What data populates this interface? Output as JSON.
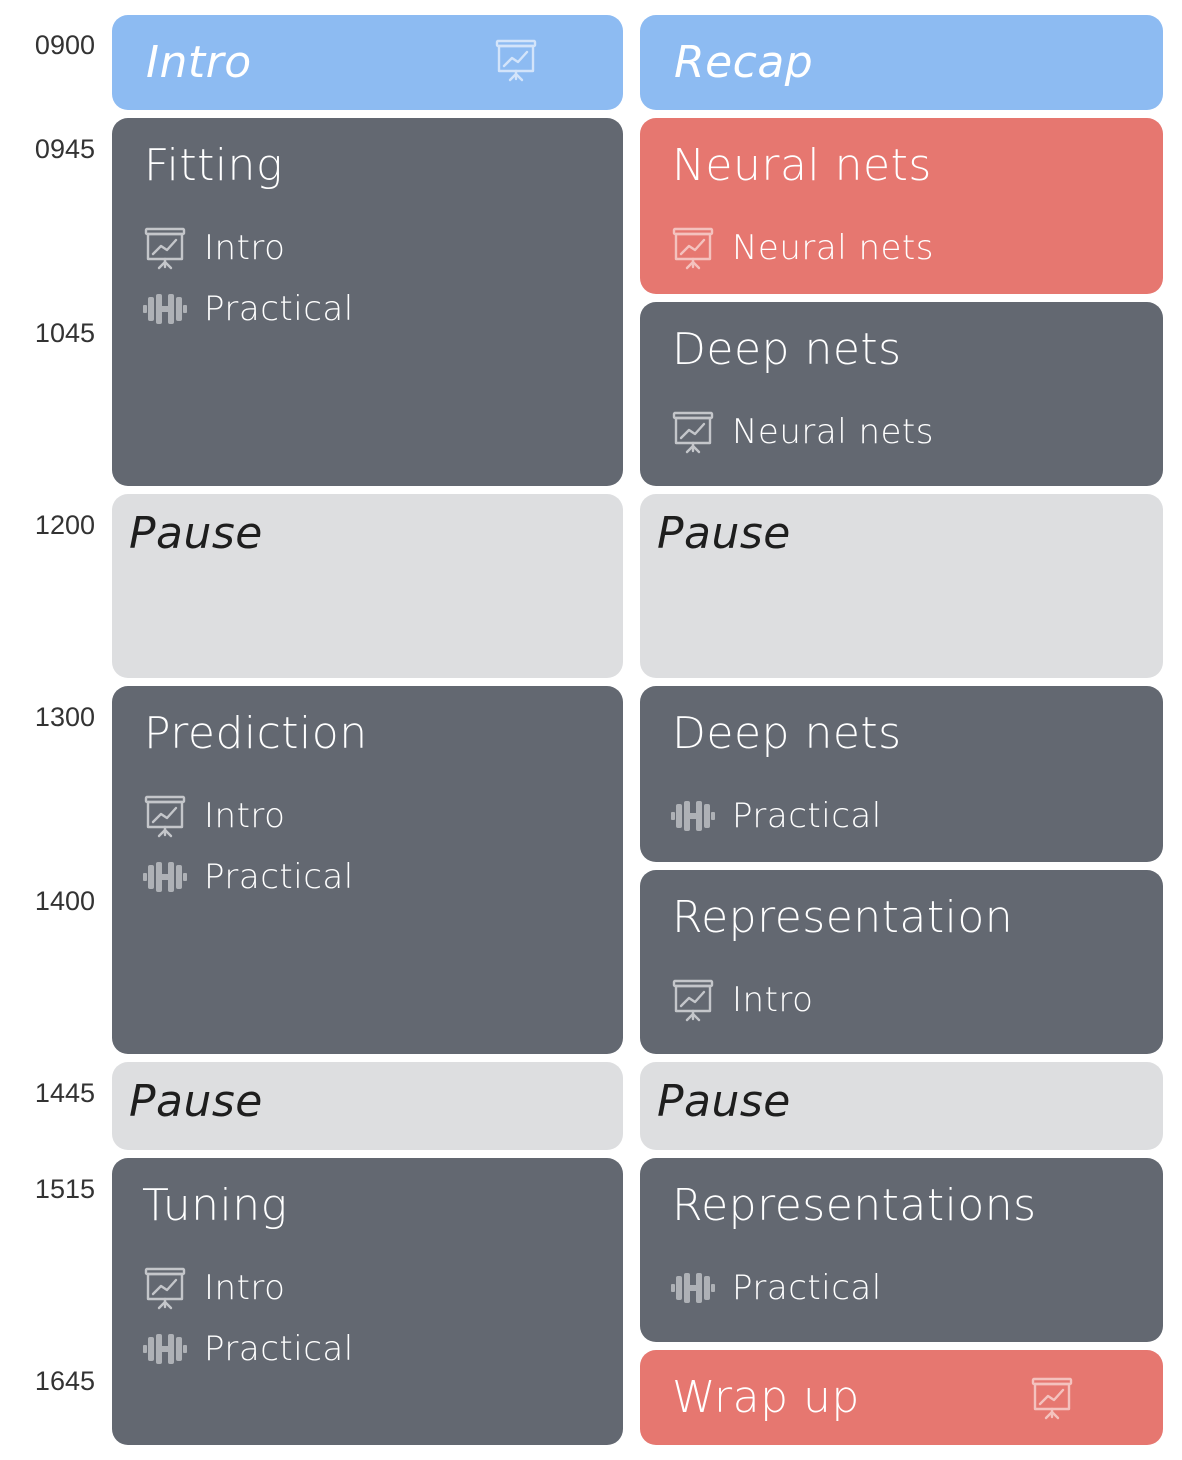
{
  "times": [
    "0900",
    "0945",
    "1045",
    "1200",
    "1300",
    "1400",
    "1445",
    "1515",
    "1645"
  ],
  "day1": {
    "intro": {
      "title": "Intro",
      "icon": "presentation-icon"
    },
    "fitting": {
      "title": "Fitting",
      "items": [
        {
          "icon": "presentation-icon",
          "label": "Intro"
        },
        {
          "icon": "dumbbell-icon",
          "label": "Practical"
        }
      ]
    },
    "pause1": {
      "title": "Pause"
    },
    "prediction": {
      "title": "Prediction",
      "items": [
        {
          "icon": "presentation-icon",
          "label": "Intro"
        },
        {
          "icon": "dumbbell-icon",
          "label": "Practical"
        }
      ]
    },
    "pause2": {
      "title": "Pause"
    },
    "tuning": {
      "title": "Tuning",
      "items": [
        {
          "icon": "presentation-icon",
          "label": "Intro"
        },
        {
          "icon": "dumbbell-icon",
          "label": "Practical"
        }
      ]
    }
  },
  "day2": {
    "recap": {
      "title": "Recap"
    },
    "neural_nets": {
      "title": "Neural nets",
      "items": [
        {
          "icon": "presentation-icon",
          "label": "Neural nets"
        }
      ]
    },
    "deep_nets_1": {
      "title": "Deep nets",
      "items": [
        {
          "icon": "presentation-icon",
          "label": "Neural nets"
        }
      ]
    },
    "pause1": {
      "title": "Pause"
    },
    "deep_nets_2": {
      "title": "Deep nets",
      "items": [
        {
          "icon": "dumbbell-icon",
          "label": "Practical"
        }
      ]
    },
    "representation": {
      "title": "Representation",
      "items": [
        {
          "icon": "presentation-icon",
          "label": "Intro"
        }
      ]
    },
    "pause2": {
      "title": "Pause"
    },
    "representations": {
      "title": "Representations",
      "items": [
        {
          "icon": "dumbbell-icon",
          "label": "Practical"
        }
      ]
    },
    "wrap_up": {
      "title": "Wrap up",
      "icon": "presentation-icon"
    }
  },
  "colors": {
    "session": "#636871",
    "highlight": "#e67770",
    "intro_recap": "#8dbbf2",
    "pause": "#dddee0",
    "icon_on_dark": "#c4c6ca",
    "icon_on_dumbbell": "#aeb1b6"
  }
}
